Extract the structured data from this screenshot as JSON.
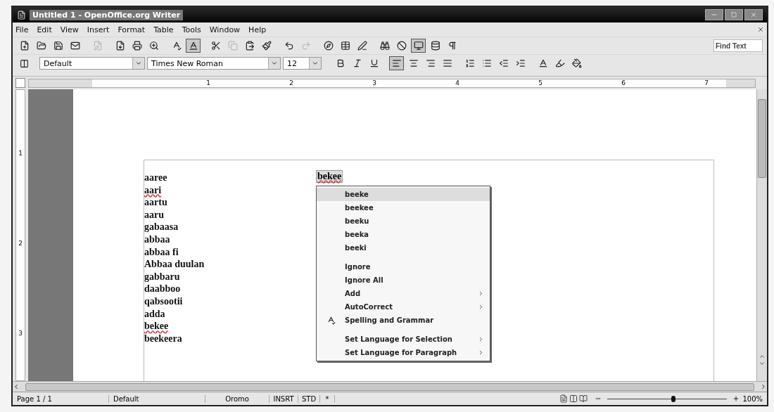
{
  "window": {
    "title": "Untitled 1 - OpenOffice.org Writer"
  },
  "menu": [
    "File",
    "Edit",
    "View",
    "Insert",
    "Format",
    "Table",
    "Tools",
    "Window",
    "Help"
  ],
  "standard_toolbar": [
    {
      "pressed": false,
      "disabled": false
    },
    {
      "pressed": false,
      "disabled": false
    },
    {
      "pressed": false,
      "disabled": false
    },
    {
      "pressed": false,
      "disabled": false
    },
    {
      "pressed": false,
      "disabled": true
    },
    {
      "pressed": false,
      "disabled": false
    },
    {
      "pressed": false,
      "disabled": false
    },
    {
      "pressed": false,
      "disabled": false
    },
    {
      "pressed": false,
      "disabled": false
    },
    {
      "pressed": true,
      "disabled": false
    },
    {
      "pressed": false,
      "disabled": false
    },
    {
      "pressed": false,
      "disabled": true
    },
    {
      "pressed": false,
      "disabled": false
    },
    {
      "pressed": false,
      "disabled": false
    },
    {
      "pressed": false,
      "disabled": false
    },
    {
      "pressed": false,
      "disabled": true
    },
    {
      "pressed": false,
      "disabled": false
    },
    {
      "pressed": false,
      "disabled": false
    },
    {
      "pressed": false,
      "disabled": false
    },
    {
      "pressed": false,
      "disabled": false
    },
    {
      "pressed": false,
      "disabled": false
    },
    {
      "pressed": true,
      "disabled": false
    },
    {
      "pressed": false,
      "disabled": false
    },
    {
      "pressed": false,
      "disabled": false
    }
  ],
  "find_toolbar": {
    "placeholder": "Find Text"
  },
  "formatting_toolbar": {
    "style": "Default",
    "font": "Times New Roman",
    "size": "12",
    "buttons": [
      {
        "pressed": false
      },
      {
        "pressed": false
      },
      {
        "pressed": false
      },
      {
        "pressed": true
      },
      {
        "pressed": false
      },
      {
        "pressed": false
      },
      {
        "pressed": false
      },
      {
        "pressed": false
      },
      {
        "pressed": false
      },
      {
        "pressed": false
      },
      {
        "pressed": false
      },
      {
        "pressed": false
      },
      {
        "pressed": false
      },
      {
        "pressed": false
      }
    ]
  },
  "ruler": {
    "labels": [
      "1",
      "2",
      "3",
      "4",
      "5",
      "6",
      "7"
    ]
  },
  "vertical_ruler": {
    "labels": [
      "1",
      "2",
      "3"
    ]
  },
  "document": {
    "words": [
      {
        "text": "aaree",
        "misspelled": false
      },
      {
        "text": "aari",
        "misspelled": true
      },
      {
        "text": "aartu",
        "misspelled": false
      },
      {
        "text": "aaru",
        "misspelled": false
      },
      {
        "text": "gabaasa",
        "misspelled": false
      },
      {
        "text": "abbaa",
        "misspelled": false
      },
      {
        "text": "abbaa fi",
        "misspelled": false
      },
      {
        "text": "Abbaa duulan",
        "misspelled": false
      },
      {
        "text": "gabbaru",
        "misspelled": false
      },
      {
        "text": "daabboo",
        "misspelled": false
      },
      {
        "text": "qabsootii",
        "misspelled": false
      },
      {
        "text": "adda",
        "misspelled": false
      },
      {
        "text": "bekee",
        "misspelled": true
      },
      {
        "text": "beekeera",
        "misspelled": false
      }
    ],
    "selected_word": {
      "text": "bekee",
      "misspelled": true
    }
  },
  "context_menu": [
    {
      "kind": "item",
      "label": "beeke",
      "selected": true
    },
    {
      "kind": "item",
      "label": "beekee",
      "selected": false
    },
    {
      "kind": "item",
      "label": "beeku",
      "selected": false
    },
    {
      "kind": "item",
      "label": "beeka",
      "selected": false
    },
    {
      "kind": "item",
      "label": "beeki",
      "selected": false
    },
    {
      "kind": "separator"
    },
    {
      "kind": "item",
      "label": "Ignore",
      "selected": false
    },
    {
      "kind": "item",
      "label": "Ignore All",
      "selected": false
    },
    {
      "kind": "submenu",
      "label": "Add",
      "selected": false
    },
    {
      "kind": "submenu",
      "label": "AutoCorrect",
      "selected": false
    },
    {
      "kind": "icon",
      "label": "Spelling and Grammar",
      "selected": false
    },
    {
      "kind": "separator"
    },
    {
      "kind": "submenu",
      "label": "Set Language for Selection",
      "selected": false
    },
    {
      "kind": "submenu",
      "label": "Set Language for Paragraph",
      "selected": false
    }
  ],
  "status_bar": {
    "page": "Page 1 / 1",
    "style": "Default",
    "language": "Oromo",
    "insert_mode": "INSRT",
    "selection_mode": "STD",
    "modified": "*",
    "zoom": "100%",
    "zoom_level": {
      "level": 0.55
    }
  }
}
